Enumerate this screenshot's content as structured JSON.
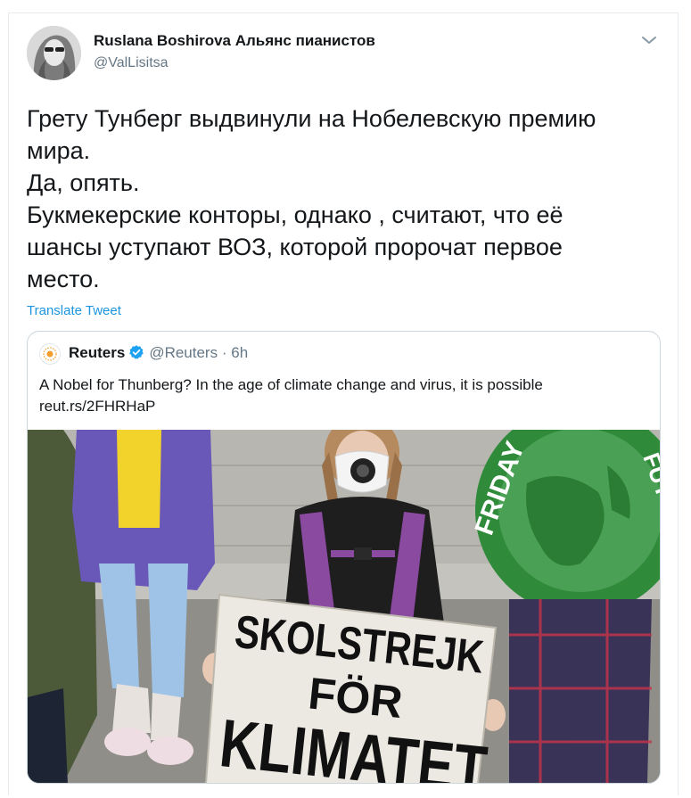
{
  "tweet": {
    "author": {
      "display_name": "Ruslana Boshirova Альянс пианистов",
      "handle": "@ValLisitsa"
    },
    "text_lines": [
      "Грету Тунберг выдвинули на Нобелевскую премию",
      "мира.",
      "Да, опять.",
      "Букмекерские конторы, однако , считают, что её",
      "шансы уступают ВОЗ, которой пророчат первое",
      "место."
    ],
    "translate_label": "Translate Tweet",
    "menu_icon": "chevron-down-icon"
  },
  "quoted_tweet": {
    "author_name": "Reuters",
    "verified_icon": "verified-badge-icon",
    "handle": "@Reuters",
    "separator": "·",
    "time": "6h",
    "text": "A Nobel for Thunberg? In the age of climate change and virus, it is possible",
    "link": "reut.rs/2FHRHaP",
    "photo": {
      "sign_line1": "SKOLSTREJK",
      "sign_line2": "FÖR",
      "sign_line3": "KLIMATET",
      "poster_text_left": "FRIDAY",
      "poster_text_right": "FUTURE"
    }
  },
  "colors": {
    "link_blue": "#1b95e0",
    "secondary_text": "#657786",
    "border": "#e6ecf0",
    "verified": "#1da1f2"
  }
}
